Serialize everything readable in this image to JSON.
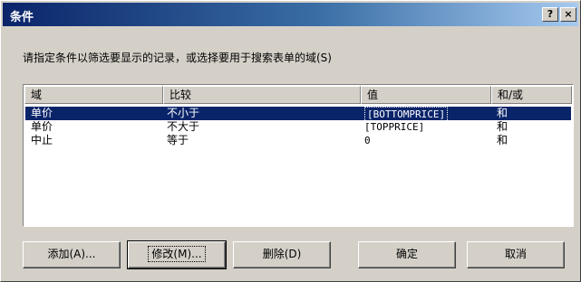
{
  "window": {
    "title": "条件",
    "help_label": "?",
    "close_label": "×"
  },
  "prompt": "请指定条件以筛选要显示的记录，或选择要用于搜索表单的域(S)",
  "list": {
    "columns": [
      "域",
      "比较",
      "值",
      "和/或"
    ],
    "rows": [
      {
        "field": "单价",
        "compare": "不小于",
        "value": "[BOTTOMPRICE]",
        "andor": "和",
        "selected": true
      },
      {
        "field": "单价",
        "compare": "不大于",
        "value": "[TOPPRICE]",
        "andor": "和",
        "selected": false
      },
      {
        "field": "中止",
        "compare": "等于",
        "value": "0",
        "andor": "和",
        "selected": false
      }
    ]
  },
  "buttons": {
    "add": "添加(A)...",
    "edit": "修改(M)...",
    "delete": "删除(D)",
    "ok": "确定",
    "cancel": "取消"
  }
}
